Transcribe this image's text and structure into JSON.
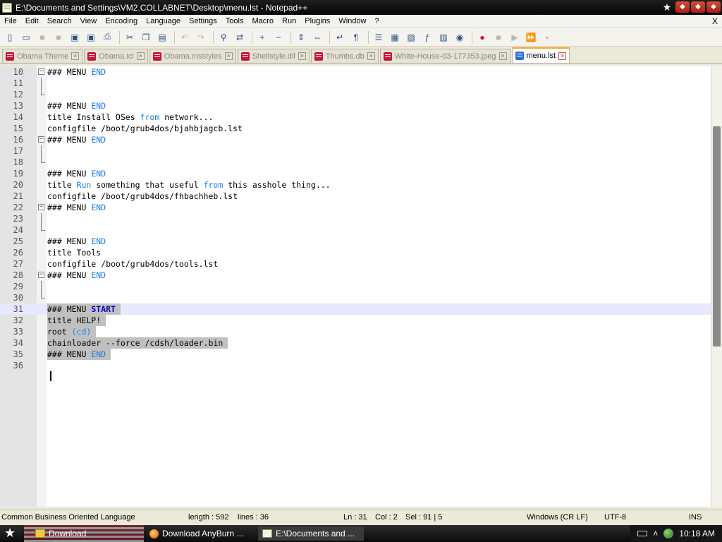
{
  "window": {
    "title": "E:\\Documents and Settings\\VM2.COLLABNET\\Desktop\\menu.lst - Notepad++",
    "buttons": {
      "star": "★",
      "restore_down": "◆",
      "restore_up": "◆",
      "close": "◆"
    }
  },
  "menubar": {
    "items": [
      "File",
      "Edit",
      "Search",
      "View",
      "Encoding",
      "Language",
      "Settings",
      "Tools",
      "Macro",
      "Run",
      "Plugins",
      "Window",
      "?"
    ],
    "close_doc": "X"
  },
  "toolbar": {
    "icons": [
      "new-file-icon",
      "open-file-icon",
      "save-icon",
      "save-all-icon",
      "close-icon",
      "close-all-icon",
      "print-icon",
      "cut-icon",
      "copy-icon",
      "paste-icon",
      "undo-icon",
      "redo-icon",
      "find-icon",
      "replace-icon",
      "zoom-in-icon",
      "zoom-out-icon",
      "sync-v-icon",
      "sync-h-icon",
      "word-wrap-icon",
      "show-all-chars-icon",
      "indent-guide-icon",
      "user-lang-icon",
      "doc-map-icon",
      "function-list-icon",
      "folder-workspace-icon",
      "monitor-icon",
      "record-macro-icon",
      "stop-record-icon",
      "play-macro-icon",
      "play-multiple-icon",
      "save-macro-icon"
    ]
  },
  "tabs": [
    {
      "label": "Obama Theme",
      "active": false
    },
    {
      "label": "Obama.icl",
      "active": false
    },
    {
      "label": "Obama.msstyles",
      "active": false
    },
    {
      "label": "Shellstyle.dll",
      "active": false
    },
    {
      "label": "Thumbs.db",
      "active": false
    },
    {
      "label": "White-House-03-177353.jpeg",
      "active": false
    },
    {
      "label": "menu.lst",
      "active": true
    }
  ],
  "editor": {
    "lines": [
      {
        "n": "10",
        "fold": "box",
        "parts": [
          {
            "t": "### MENU "
          },
          {
            "t": "END",
            "c": "kw"
          }
        ]
      },
      {
        "n": "11",
        "fold": "line",
        "parts": []
      },
      {
        "n": "12",
        "fold": "end",
        "parts": []
      },
      {
        "n": "13",
        "fold": "",
        "parts": [
          {
            "t": "### MENU "
          },
          {
            "t": "END",
            "c": "kw"
          }
        ]
      },
      {
        "n": "14",
        "fold": "",
        "parts": [
          {
            "t": "title Install OSes "
          },
          {
            "t": "from",
            "c": "kw"
          },
          {
            "t": " network..."
          }
        ]
      },
      {
        "n": "15",
        "fold": "",
        "parts": [
          {
            "t": "configfile /boot/grub4dos/bjahbjagcb.lst"
          }
        ]
      },
      {
        "n": "16",
        "fold": "box",
        "parts": [
          {
            "t": "### MENU "
          },
          {
            "t": "END",
            "c": "kw"
          }
        ]
      },
      {
        "n": "17",
        "fold": "line",
        "parts": []
      },
      {
        "n": "18",
        "fold": "end",
        "parts": []
      },
      {
        "n": "19",
        "fold": "",
        "parts": [
          {
            "t": "### MENU "
          },
          {
            "t": "END",
            "c": "kw"
          }
        ]
      },
      {
        "n": "20",
        "fold": "",
        "parts": [
          {
            "t": "title "
          },
          {
            "t": "Run",
            "c": "kw"
          },
          {
            "t": " something that useful "
          },
          {
            "t": "from",
            "c": "kw"
          },
          {
            "t": " this asshole thing..."
          }
        ]
      },
      {
        "n": "21",
        "fold": "",
        "parts": [
          {
            "t": "configfile /boot/grub4dos/fhbachheb.lst"
          }
        ]
      },
      {
        "n": "22",
        "fold": "box",
        "parts": [
          {
            "t": "### MENU "
          },
          {
            "t": "END",
            "c": "kw"
          }
        ]
      },
      {
        "n": "23",
        "fold": "line",
        "parts": []
      },
      {
        "n": "24",
        "fold": "end",
        "parts": []
      },
      {
        "n": "25",
        "fold": "",
        "parts": [
          {
            "t": "### MENU "
          },
          {
            "t": "END",
            "c": "kw"
          }
        ]
      },
      {
        "n": "26",
        "fold": "",
        "parts": [
          {
            "t": "title Tools"
          }
        ]
      },
      {
        "n": "27",
        "fold": "",
        "parts": [
          {
            "t": "configfile /boot/grub4dos/tools.lst"
          }
        ]
      },
      {
        "n": "28",
        "fold": "box",
        "parts": [
          {
            "t": "### MENU "
          },
          {
            "t": "END",
            "c": "kw"
          }
        ]
      },
      {
        "n": "29",
        "fold": "line",
        "parts": []
      },
      {
        "n": "30",
        "fold": "end",
        "parts": []
      },
      {
        "n": "31",
        "fold": "",
        "current": true,
        "selected": true,
        "parts": [
          {
            "t": "### MENU "
          },
          {
            "t": "START",
            "c": "kw2"
          },
          {
            "t": " "
          }
        ]
      },
      {
        "n": "32",
        "fold": "",
        "selected": true,
        "parts": [
          {
            "t": "title HELP! "
          }
        ]
      },
      {
        "n": "33",
        "fold": "",
        "selected": true,
        "parts": [
          {
            "t": "root "
          },
          {
            "t": "(cd)",
            "c": "kw"
          },
          {
            "t": " "
          }
        ]
      },
      {
        "n": "34",
        "fold": "",
        "selected": true,
        "parts": [
          {
            "t": "chainloader --force /cdsh/loader.bin "
          }
        ]
      },
      {
        "n": "35",
        "fold": "",
        "selected": true,
        "parts": [
          {
            "t": "### MENU "
          },
          {
            "t": "END",
            "c": "kw"
          },
          {
            "t": " "
          }
        ]
      },
      {
        "n": "36",
        "fold": "",
        "parts": []
      }
    ]
  },
  "statusbar": {
    "language": "Common Business Oriented Language",
    "length": "length : 592",
    "lines": "lines : 36",
    "ln": "Ln : 31",
    "col": "Col : 2",
    "sel": "Sel : 91 | 5",
    "eol": "Windows (CR LF)",
    "encoding": "UTF-8",
    "mode": "INS"
  },
  "taskbar": {
    "tasks": [
      {
        "label": "Download",
        "icon": "folder-icon"
      },
      {
        "label": "Download AnyBurn ...",
        "icon": "firefox-icon"
      },
      {
        "label": "E:\\Documents and ...",
        "icon": "notepad-icon"
      }
    ],
    "clock": "10:18 AM"
  },
  "colors": {
    "keyword": "#1a7ee0",
    "keyword_bold": "#0000c8",
    "selection": "#c0c0c0",
    "current_line": "#e8e8ff",
    "active_tab_accent": "#f6a728"
  }
}
